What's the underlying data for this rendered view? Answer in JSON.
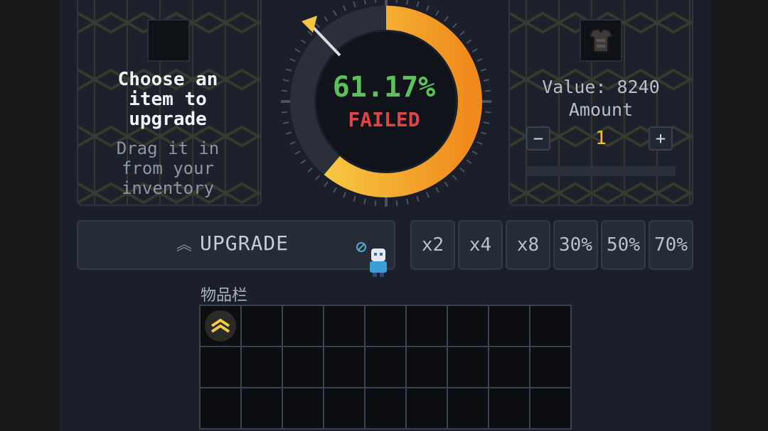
{
  "left_panel": {
    "title_line1": "Choose an",
    "title_line2": "item to",
    "title_line3": "upgrade",
    "hint_line1": "Drag it in",
    "hint_line2": "from your",
    "hint_line3": "inventory"
  },
  "dial": {
    "chance_text": "61.17%",
    "chance_value": 61.17,
    "result_text": "FAILED",
    "needle_icon": "arrow-pointer-icon",
    "colors": {
      "fill": "#f5a623",
      "track": "#2a2f39",
      "result": "#e04545",
      "chance": "#5cc15a"
    }
  },
  "right_panel": {
    "item_icon": "chestplate-icon",
    "value_text": "Value: 8240",
    "amount_label": "Amount",
    "minus_label": "−",
    "plus_label": "+",
    "amount_value": "1"
  },
  "actions": {
    "upgrade_label": "UPGRADE",
    "upgrade_icon": "double-chevron-up-icon",
    "multipliers": [
      "x2",
      "x4",
      "x8",
      "30%",
      "50%",
      "70%"
    ]
  },
  "inventory": {
    "title": "物品栏",
    "first_item_icon": "upgrade-token-icon"
  }
}
